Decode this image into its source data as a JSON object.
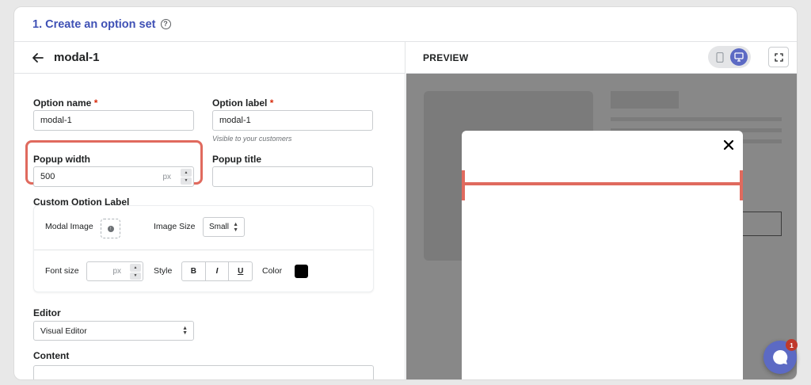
{
  "header": {
    "title": "1. Create an option set",
    "help_icon": "?"
  },
  "editor": {
    "back_icon": "arrow-left-icon",
    "title": "modal-1",
    "option_name": {
      "label": "Option name",
      "required": "*",
      "value": "modal-1"
    },
    "option_label": {
      "label": "Option label",
      "required": "*",
      "value": "modal-1",
      "help": "Visible to your customers"
    },
    "popup_width": {
      "label": "Popup width",
      "value": "500",
      "unit": "px"
    },
    "popup_title": {
      "label": "Popup title",
      "value": ""
    },
    "custom_option_label": {
      "label": "Custom Option Label",
      "modal_image_label": "Modal Image",
      "image_size_label": "Image Size",
      "image_size_value": "Small",
      "font_size_label": "Font size",
      "font_size_unit": "px",
      "style_label": "Style",
      "bold": "B",
      "italic": "I",
      "underline": "U",
      "color_label": "Color",
      "color_value": "#000000"
    },
    "editor_field": {
      "label": "Editor",
      "value": "Visual Editor"
    },
    "content": {
      "label": "Content"
    }
  },
  "preview": {
    "title": "PREVIEW",
    "device_active": "desktop"
  },
  "chat": {
    "badge": "1"
  }
}
